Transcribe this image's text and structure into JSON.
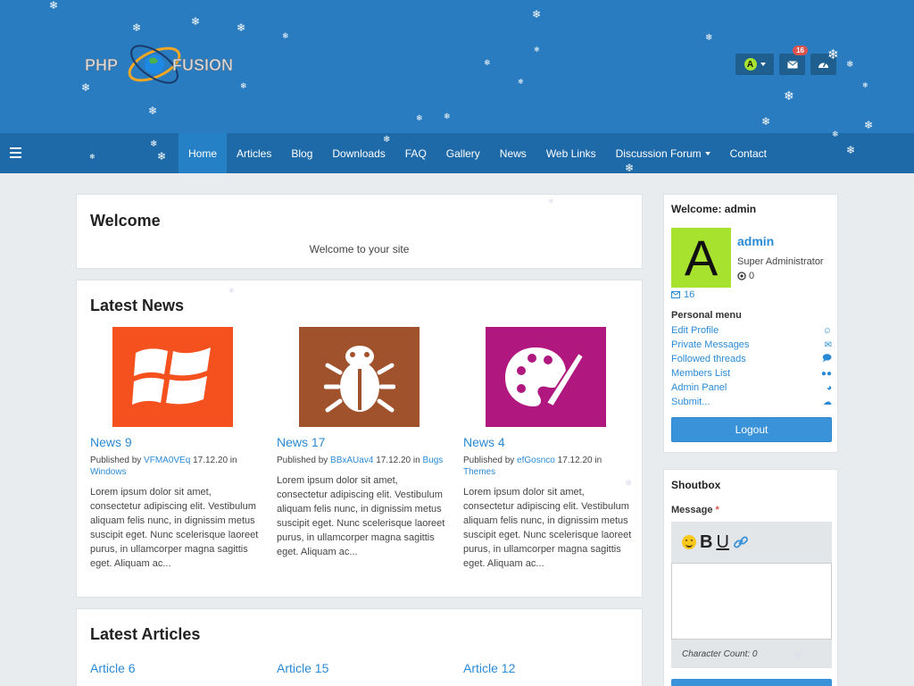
{
  "header": {
    "logo_alt": "PHP-FUSION",
    "user_initial": "A",
    "message_count": "16"
  },
  "nav": {
    "items": [
      {
        "label": "Home",
        "active": true
      },
      {
        "label": "Articles"
      },
      {
        "label": "Blog"
      },
      {
        "label": "Downloads"
      },
      {
        "label": "FAQ"
      },
      {
        "label": "Gallery"
      },
      {
        "label": "News"
      },
      {
        "label": "Web Links"
      },
      {
        "label": "Discussion Forum",
        "dropdown": true
      },
      {
        "label": "Contact"
      }
    ]
  },
  "welcome": {
    "title": "Welcome",
    "message": "Welcome to your site"
  },
  "latest_news": {
    "title": "Latest News",
    "items": [
      {
        "title": "News 9",
        "published_by": "Published by",
        "author": "VFMA0VEq",
        "date": "17.12.20",
        "in": "in",
        "category": "Windows",
        "excerpt": "Lorem ipsum dolor sit amet, consectetur adipiscing elit. Vestibulum aliquam felis nunc, in dignissim metus suscipit eget. Nunc scelerisque laoreet purus, in ullamcorper magna sagittis eget. Aliquam ac...",
        "thumb_color": "#f4511e",
        "icon": "windows-icon"
      },
      {
        "title": "News 17",
        "published_by": "Published by",
        "author": "BBxAUav4",
        "date": "17.12.20",
        "in": "in",
        "category": "Bugs",
        "excerpt": "Lorem ipsum dolor sit amet, consectetur adipiscing elit. Vestibulum aliquam felis nunc, in dignissim metus suscipit eget. Nunc scelerisque laoreet purus, in ullamcorper magna sagittis eget. Aliquam ac...",
        "thumb_color": "#a0522d",
        "icon": "bug-icon"
      },
      {
        "title": "News 4",
        "published_by": "Published by",
        "author": "efGosnco",
        "date": "17.12.20",
        "in": "in",
        "category": "Themes",
        "excerpt": "Lorem ipsum dolor sit amet, consectetur adipiscing elit. Vestibulum aliquam felis nunc, in dignissim metus suscipit eget. Nunc scelerisque laoreet purus, in ullamcorper magna sagittis eget. Aliquam ac...",
        "thumb_color": "#b0177f",
        "icon": "palette-icon"
      }
    ]
  },
  "latest_articles": {
    "title": "Latest Articles",
    "items": [
      {
        "title": "Article 6"
      },
      {
        "title": "Article 15"
      },
      {
        "title": "Article 12"
      }
    ]
  },
  "user_panel": {
    "title": "Welcome: admin",
    "avatar_initial": "A",
    "username": "admin",
    "role": "Super Administrator",
    "points": "0",
    "messages": "16",
    "personal_menu_title": "Personal menu",
    "menu": [
      {
        "label": "Edit Profile",
        "icon": "user-circle-icon"
      },
      {
        "label": "Private Messages",
        "icon": "envelope-icon"
      },
      {
        "label": "Followed threads",
        "icon": "comments-icon"
      },
      {
        "label": "Members List",
        "icon": "users-icon"
      },
      {
        "label": "Admin Panel",
        "icon": "dashboard-icon"
      },
      {
        "label": "Submit...",
        "icon": "cloud-upload-icon"
      }
    ],
    "logout_label": "Logout"
  },
  "shoutbox": {
    "title": "Shoutbox",
    "message_label": "Message",
    "required_mark": "*",
    "character_count": "Character Count: 0"
  }
}
